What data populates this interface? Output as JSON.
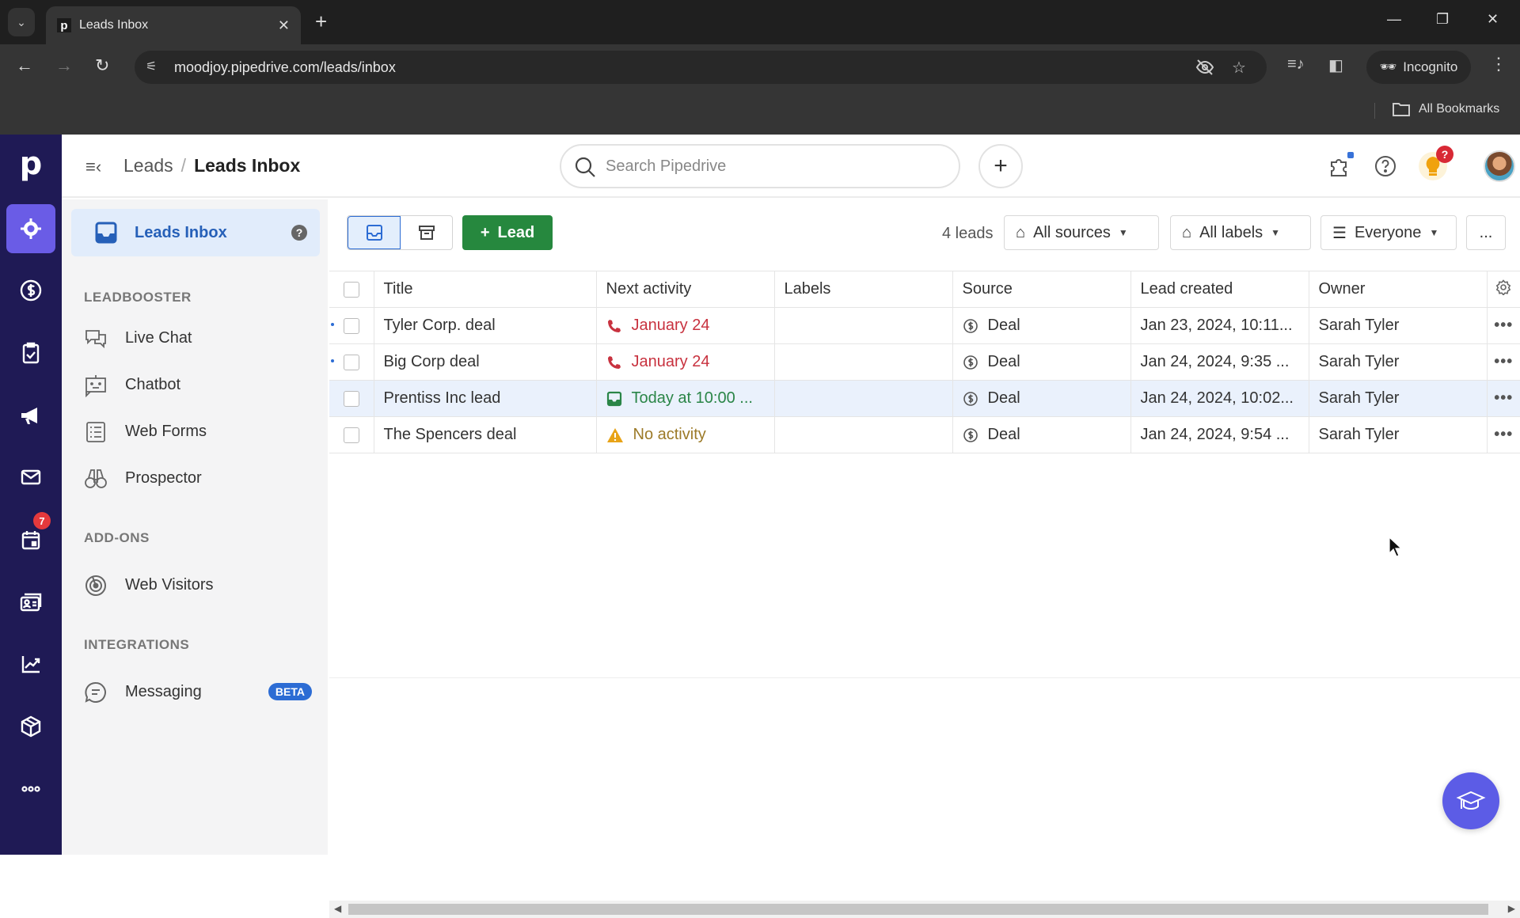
{
  "browser": {
    "tab_title": "Leads Inbox",
    "url": "moodjoy.pipedrive.com/leads/inbox",
    "incognito_label": "Incognito",
    "bookmarks_label": "All Bookmarks"
  },
  "header": {
    "breadcrumb_parent": "Leads",
    "breadcrumb_separator": "/",
    "breadcrumb_current": "Leads Inbox",
    "search_placeholder": "Search Pipedrive",
    "add_label": "+",
    "tips_badge": "?"
  },
  "rail": {
    "logo": "p",
    "items": [
      {
        "name": "leads",
        "active": true
      },
      {
        "name": "deals"
      },
      {
        "name": "activities-tasks"
      },
      {
        "name": "campaigns"
      },
      {
        "name": "mail"
      },
      {
        "name": "calendar",
        "badge": "7"
      },
      {
        "name": "contacts"
      },
      {
        "name": "insights"
      },
      {
        "name": "products"
      },
      {
        "name": "more"
      }
    ]
  },
  "sidenav": {
    "active_item": "Leads Inbox",
    "sections": [
      {
        "heading": "LEADBOOSTER",
        "items": [
          "Live Chat",
          "Chatbot",
          "Web Forms",
          "Prospector"
        ]
      },
      {
        "heading": "ADD-ONS",
        "items": [
          "Web Visitors"
        ]
      },
      {
        "heading": "INTEGRATIONS",
        "items": [
          "Messaging"
        ]
      }
    ],
    "messaging_badge": "BETA"
  },
  "toolbar": {
    "lead_button": "Lead",
    "count": "4 leads",
    "filters": {
      "sources": "All sources",
      "labels": "All labels",
      "owner": "Everyone"
    },
    "more": "..."
  },
  "table": {
    "columns": [
      "Title",
      "Next activity",
      "Labels",
      "Source",
      "Lead created",
      "Owner"
    ],
    "rows": [
      {
        "title": "Tyler Corp. deal",
        "next_activity": "January 24",
        "activity_type": "call-overdue",
        "labels": "",
        "source": "Deal",
        "created": "Jan 23, 2024, 10:11...",
        "owner": "Sarah Tyler",
        "unread": true
      },
      {
        "title": "Big Corp deal",
        "next_activity": "January 24",
        "activity_type": "call-overdue",
        "labels": "",
        "source": "Deal",
        "created": "Jan 24, 2024, 9:35 ...",
        "owner": "Sarah Tyler",
        "unread": true
      },
      {
        "title": "Prentiss Inc lead",
        "next_activity": "Today at 10:00 ...",
        "activity_type": "email-today",
        "labels": "",
        "source": "Deal",
        "created": "Jan 24, 2024, 10:02...",
        "owner": "Sarah Tyler",
        "highlighted": true
      },
      {
        "title": "The Spencers deal",
        "next_activity": "No activity",
        "activity_type": "warning",
        "labels": "",
        "source": "Deal",
        "created": "Jan 24, 2024, 9:54 ...",
        "owner": "Sarah Tyler"
      }
    ],
    "row_menu": "•••"
  },
  "colors": {
    "rail": "#1f1a55",
    "rail_active": "#6a5ce6",
    "primary_green": "#26883e",
    "link_blue": "#2660b8",
    "overdue_red": "#c8323f",
    "today_green": "#2a8547",
    "warning_amber": "#e8a317"
  }
}
